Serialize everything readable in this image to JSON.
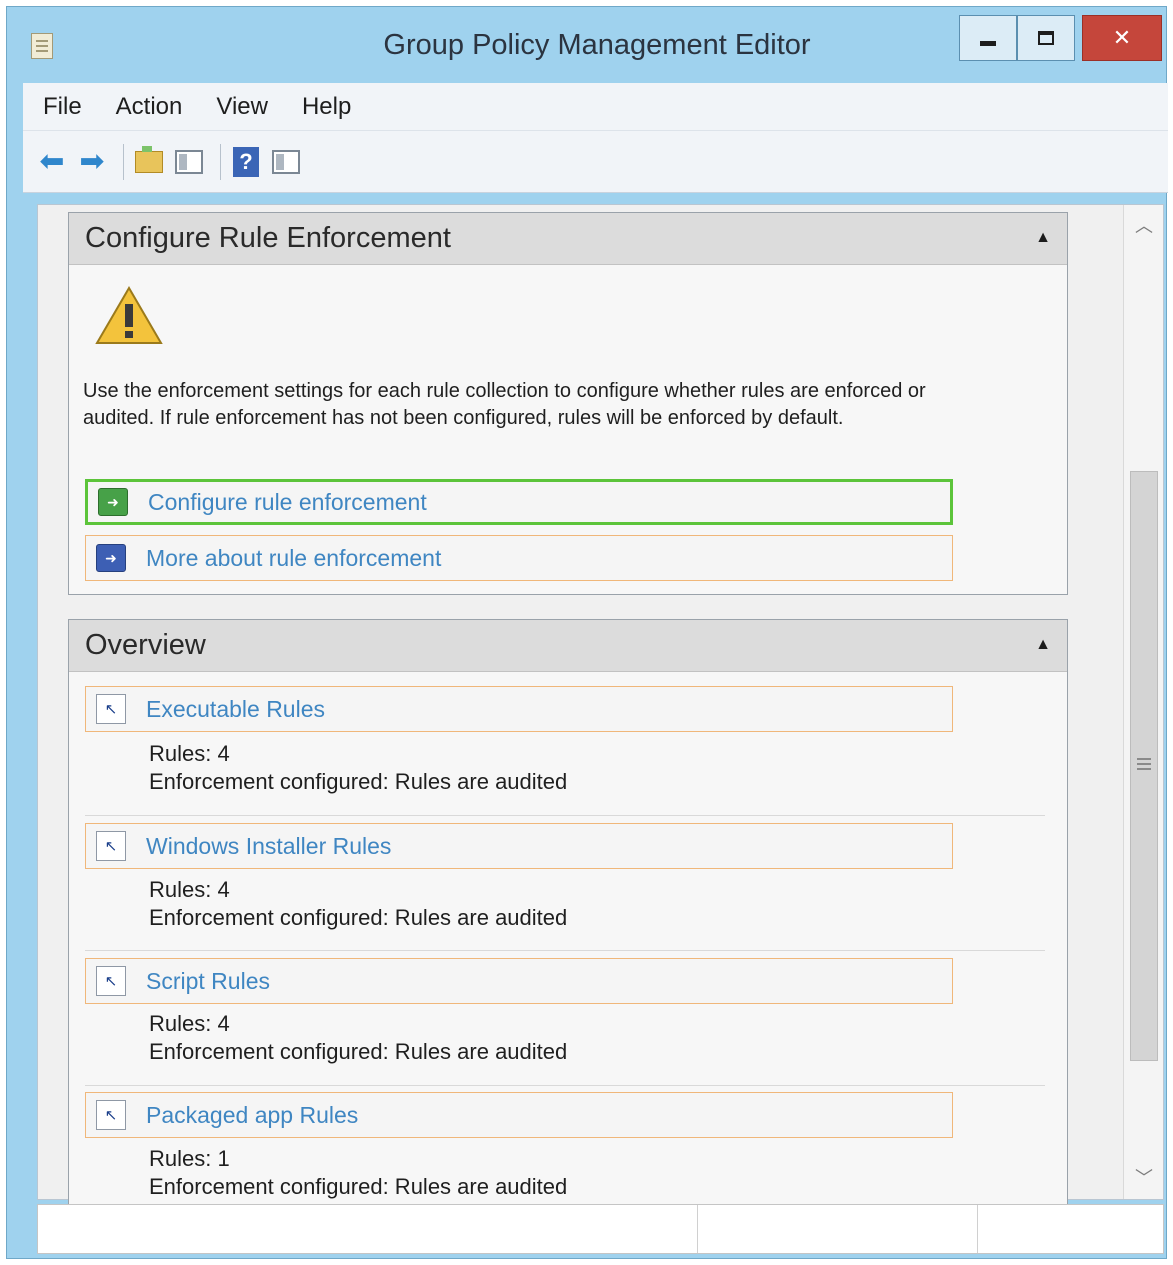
{
  "window": {
    "title": "Group Policy Management Editor"
  },
  "menu": {
    "items": [
      "File",
      "Action",
      "View",
      "Help"
    ]
  },
  "toolbar": {
    "icons": [
      "back-arrow-icon",
      "forward-arrow-icon",
      "up-folder-icon",
      "show-hide-console-tree-icon",
      "help-icon",
      "show-hide-action-pane-icon"
    ]
  },
  "enforcement": {
    "title": "Configure Rule Enforcement",
    "description": "Use the enforcement settings for each rule collection to configure whether rules are enforced or audited. If rule enforcement has not been configured, rules will be enforced by default.",
    "links": [
      {
        "label": "Configure rule enforcement",
        "selected": true
      },
      {
        "label": "More about rule enforcement",
        "selected": false
      }
    ]
  },
  "overview": {
    "title": "Overview",
    "rules": [
      {
        "name": "Executable Rules",
        "count": "Rules: 4",
        "enforcement": "Enforcement configured: Rules are audited"
      },
      {
        "name": "Windows Installer Rules",
        "count": "Rules: 4",
        "enforcement": "Enforcement configured: Rules are audited"
      },
      {
        "name": "Script Rules",
        "count": "Rules: 4",
        "enforcement": "Enforcement configured: Rules are audited"
      },
      {
        "name": "Packaged app Rules",
        "count": "Rules: 1",
        "enforcement": "Enforcement configured: Rules are audited"
      }
    ]
  },
  "colors": {
    "title_bar": "#9fd2ee",
    "link_text": "#3f86c2",
    "link_border": "#f0b77a",
    "selected_border": "#5cc43a",
    "close_button": "#c5463b"
  }
}
